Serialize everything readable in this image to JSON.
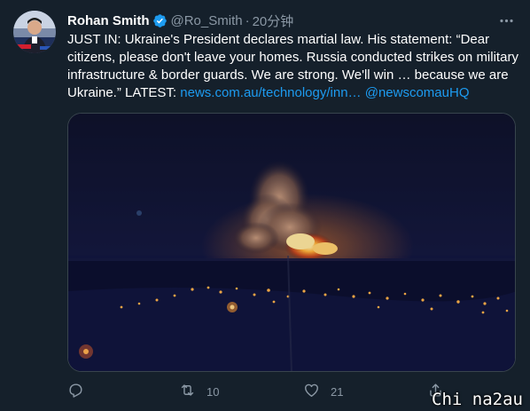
{
  "author": {
    "name": "Rohan Smith",
    "handle": "@Ro_Smith",
    "separator": "·",
    "time": "20分钟",
    "verified": true
  },
  "tweet": {
    "text_main": "JUST IN: Ukraine's President declares martial law. His statement: “Dear citizens, please don't leave your homes. Russia conducted strikes on military infrastructure & border guards. We are strong. We'll win … because we are Ukraine.” LATEST: ",
    "link": "news.com.au/technology/inn…",
    "mention": "@newscomauHQ"
  },
  "actions": {
    "reply_count": "",
    "retweet_count": "10",
    "like_count": "21"
  },
  "watermark": "Chi na2au",
  "colors": {
    "background": "#15202b",
    "link": "#1d9bf0",
    "verified": "#1d9bf0",
    "muted": "#8b98a5"
  }
}
